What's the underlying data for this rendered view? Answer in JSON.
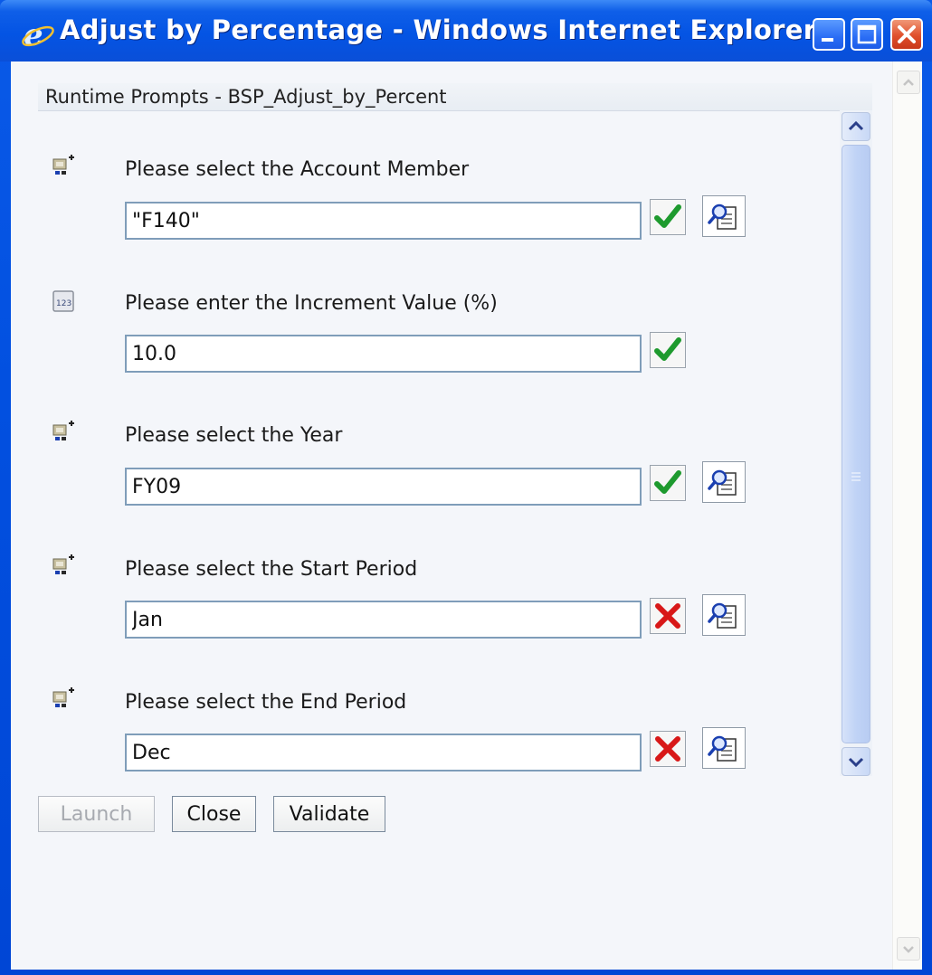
{
  "window": {
    "title": "Adjust by Percentage - Windows Internet Explorer",
    "app_icon": "internet-explorer-icon",
    "controls": [
      "minimize-icon",
      "maximize-icon",
      "close-icon"
    ]
  },
  "header": {
    "title": "Runtime Prompts - BSP_Adjust_by_Percent"
  },
  "prompts": [
    {
      "label": "Please select the Account Member",
      "value": "\"F140\"",
      "type_icon": "member-selection-icon",
      "status": "valid",
      "status_icon": "green-checkmark-icon",
      "has_lookup": true
    },
    {
      "label": "Please enter the Increment Value (%)",
      "value": "10.0",
      "type_icon": "numeric-123-icon",
      "status": "valid",
      "status_icon": "green-checkmark-icon",
      "has_lookup": false
    },
    {
      "label": "Please select the Year",
      "value": "FY09",
      "type_icon": "member-selection-icon",
      "status": "valid",
      "status_icon": "green-checkmark-icon",
      "has_lookup": true
    },
    {
      "label": "Please select the Start Period",
      "value": "Jan",
      "type_icon": "member-selection-icon",
      "status": "invalid",
      "status_icon": "red-x-icon",
      "has_lookup": true
    },
    {
      "label": "Please select the End Period",
      "value": "Dec",
      "type_icon": "member-selection-icon",
      "status": "invalid",
      "status_icon": "red-x-icon",
      "has_lookup": true
    }
  ],
  "buttons": {
    "launch": {
      "label": "Launch",
      "enabled": false
    },
    "close": {
      "label": "Close",
      "enabled": true
    },
    "validate": {
      "label": "Validate",
      "enabled": true
    }
  },
  "colors": {
    "title_bar": "#0454e4",
    "valid": "#1e9a2e",
    "invalid": "#d81818",
    "field_border": "#7f9db9"
  }
}
